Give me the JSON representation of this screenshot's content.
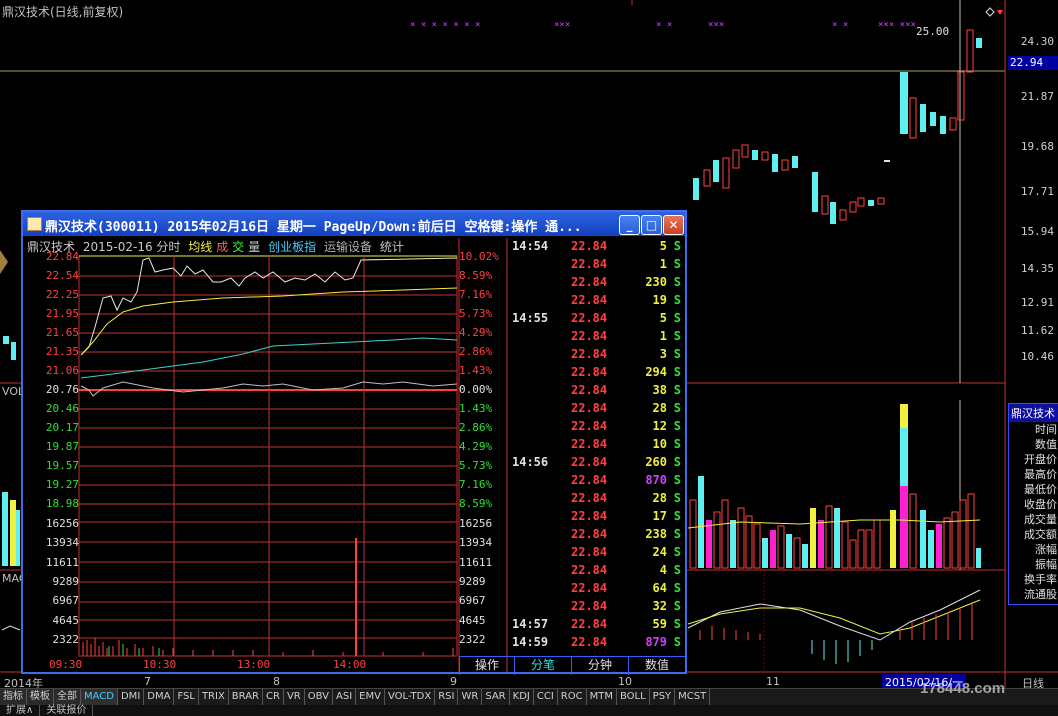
{
  "main_chart": {
    "title": "鼎汉技术(日线,前复权)",
    "peak_label": "25.00",
    "current_price": "22.94",
    "price_axis": [
      "24.30",
      "21.87",
      "19.68",
      "17.71",
      "15.94",
      "14.35",
      "12.91",
      "11.62",
      "10.46"
    ],
    "vol_label": "VOL",
    "macd_label": "MAC",
    "date_marks": [
      "2014年",
      "7",
      "8",
      "9",
      "10",
      "11"
    ],
    "selected_date": "2015/02/16/一",
    "period": "日线"
  },
  "info_panel": {
    "header": "鼎汉技术",
    "rows": [
      "时间",
      "数值",
      "开盘价",
      "最高价",
      "最低价",
      "收盘价",
      "成交量",
      "成交额",
      "涨幅",
      "振幅",
      "换手率",
      "流通股"
    ]
  },
  "popup": {
    "title": "鼎汉技术(300011) 2015年02月16日 星期一 PageUp/Down:前后日 空格键:操作 通...",
    "header": {
      "name": "鼎汉技术",
      "date": "2015-02-16 分时",
      "avg": "均线",
      "vol_a": "成",
      "vol_b": "交",
      "vol_c": "量",
      "gem": "创业板指",
      "run": "运输设备",
      "stat": "统计"
    },
    "price_left": [
      "22.84",
      "22.54",
      "22.25",
      "21.95",
      "21.65",
      "21.35",
      "21.06",
      "20.76",
      "20.46",
      "20.17",
      "19.87",
      "19.57",
      "19.27",
      "18.98"
    ],
    "pct_right": [
      "10.02%",
      "8.59%",
      "7.16%",
      "5.73%",
      "4.29%",
      "2.86%",
      "1.43%",
      "0.00%",
      "1.43%",
      "2.86%",
      "4.29%",
      "5.73%",
      "7.16%",
      "8.59%"
    ],
    "vol_ticks": [
      "16256",
      "13934",
      "11611",
      "9289",
      "6967",
      "4645",
      "2322"
    ],
    "time_ticks": [
      "09:30",
      "10:30",
      "13:00",
      "14:00"
    ],
    "ticks": [
      {
        "time": "14:54",
        "price": "22.84",
        "vol": "5",
        "side": "S"
      },
      {
        "time": "",
        "price": "22.84",
        "vol": "1",
        "side": "S"
      },
      {
        "time": "",
        "price": "22.84",
        "vol": "230",
        "side": "S"
      },
      {
        "time": "",
        "price": "22.84",
        "vol": "19",
        "side": "S"
      },
      {
        "time": "14:55",
        "price": "22.84",
        "vol": "5",
        "side": "S"
      },
      {
        "time": "",
        "price": "22.84",
        "vol": "1",
        "side": "S"
      },
      {
        "time": "",
        "price": "22.84",
        "vol": "3",
        "side": "S"
      },
      {
        "time": "",
        "price": "22.84",
        "vol": "294",
        "side": "S"
      },
      {
        "time": "",
        "price": "22.84",
        "vol": "38",
        "side": "S"
      },
      {
        "time": "",
        "price": "22.84",
        "vol": "28",
        "side": "S"
      },
      {
        "time": "",
        "price": "22.84",
        "vol": "12",
        "side": "S"
      },
      {
        "time": "",
        "price": "22.84",
        "vol": "10",
        "side": "S"
      },
      {
        "time": "14:56",
        "price": "22.84",
        "vol": "260",
        "side": "S"
      },
      {
        "time": "",
        "price": "22.84",
        "vol": "870",
        "side": "S"
      },
      {
        "time": "",
        "price": "22.84",
        "vol": "28",
        "side": "S"
      },
      {
        "time": "",
        "price": "22.84",
        "vol": "17",
        "side": "S"
      },
      {
        "time": "",
        "price": "22.84",
        "vol": "238",
        "side": "S"
      },
      {
        "time": "",
        "price": "22.84",
        "vol": "24",
        "side": "S"
      },
      {
        "time": "",
        "price": "22.84",
        "vol": "4",
        "side": "S"
      },
      {
        "time": "",
        "price": "22.84",
        "vol": "64",
        "side": "S"
      },
      {
        "time": "",
        "price": "22.84",
        "vol": "32",
        "side": "S"
      },
      {
        "time": "14:57",
        "price": "22.84",
        "vol": "59",
        "side": "S"
      },
      {
        "time": "14:59",
        "price": "22.84",
        "vol": "879",
        "side": "S"
      }
    ],
    "tabs": [
      "操作",
      "分笔",
      "分钟",
      "数值"
    ]
  },
  "indicators": [
    "指标",
    "模板",
    "全部",
    "MACD",
    "DMI",
    "DMA",
    "FSL",
    "TRIX",
    "BRAR",
    "CR",
    "VR",
    "OBV",
    "ASI",
    "EMV",
    "VOL-TDX",
    "RSI",
    "WR",
    "SAR",
    "KDJ",
    "CCI",
    "ROC",
    "MTM",
    "BOLL",
    "PSY",
    "MCST"
  ],
  "bottom_tabs": [
    "扩展∧",
    "关联报价"
  ],
  "watermark": "178448.com"
}
